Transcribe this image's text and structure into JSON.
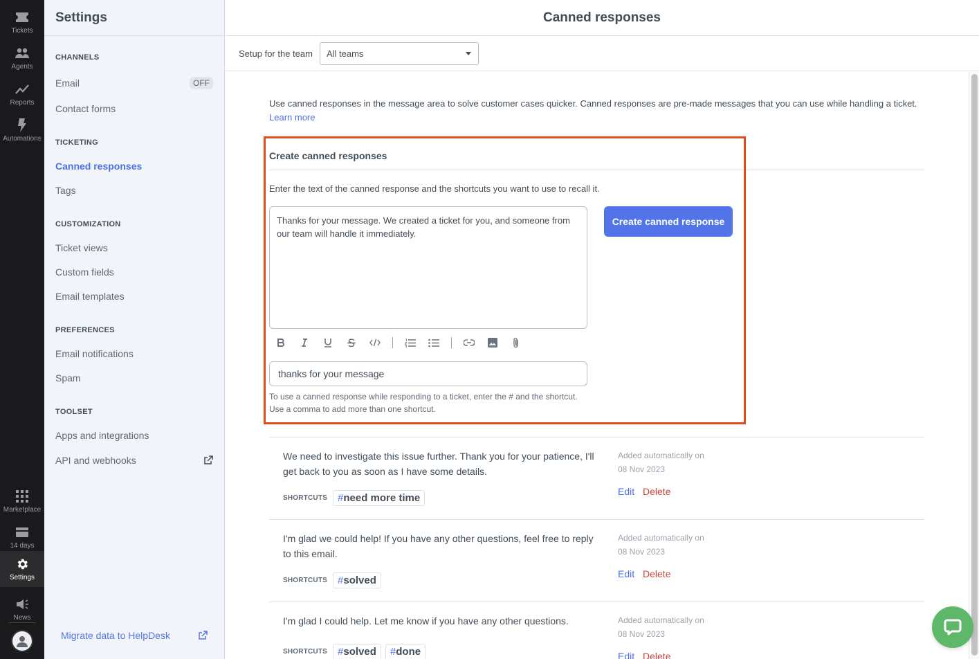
{
  "rail": {
    "items": [
      {
        "label": "Tickets",
        "icon": "ticket-icon"
      },
      {
        "label": "Agents",
        "icon": "agents-icon"
      },
      {
        "label": "Reports",
        "icon": "reports-icon"
      },
      {
        "label": "Automations",
        "icon": "lightning-icon"
      }
    ],
    "bottom": [
      {
        "label": "Marketplace",
        "icon": "grid-icon"
      },
      {
        "label": "14 days",
        "icon": "card-icon"
      },
      {
        "label": "Settings",
        "icon": "gear-icon",
        "active": true
      },
      {
        "label": "News",
        "icon": "megaphone-icon"
      }
    ]
  },
  "sidebar": {
    "title": "Settings",
    "sections": [
      {
        "title": "CHANNELS",
        "items": [
          {
            "label": "Email",
            "badge": "OFF"
          },
          {
            "label": "Contact forms"
          }
        ]
      },
      {
        "title": "TICKETING",
        "items": [
          {
            "label": "Canned responses",
            "active": true
          },
          {
            "label": "Tags"
          }
        ]
      },
      {
        "title": "CUSTOMIZATION",
        "items": [
          {
            "label": "Ticket views"
          },
          {
            "label": "Custom fields"
          },
          {
            "label": "Email templates"
          }
        ]
      },
      {
        "title": "PREFERENCES",
        "items": [
          {
            "label": "Email notifications"
          },
          {
            "label": "Spam"
          }
        ]
      },
      {
        "title": "TOOLSET",
        "items": [
          {
            "label": "Apps and integrations"
          },
          {
            "label": "API and webhooks",
            "external": true
          }
        ]
      }
    ],
    "migrate_link": "Migrate data to HelpDesk"
  },
  "header": {
    "title": "Canned responses"
  },
  "team_bar": {
    "label": "Setup for the team",
    "selected": "All teams"
  },
  "intro": {
    "text": "Use canned responses in the message area to solve customer cases quicker. Canned responses are pre-made messages that you can use while handling a ticket.",
    "learn_more": "Learn more"
  },
  "create": {
    "title": "Create canned responses",
    "description": "Enter the text of the canned response and the shortcuts you want to use to recall it.",
    "editor_value": "Thanks for your message. We created a ticket for you, and someone from our team will handle it immediately.",
    "toolbar": [
      "bold",
      "italic",
      "underline",
      "strikethrough",
      "code",
      "ordered-list",
      "bullet-list",
      "link",
      "image",
      "attachment"
    ],
    "shortcut_value": "thanks for your message",
    "shortcut_help": "To use a canned response while responding to a ticket, enter the # and the shortcut. Use a comma to add more than one shortcut.",
    "button": "Create canned response"
  },
  "responses": [
    {
      "text": "We need to investigate this issue further. Thank you for your patience, I'll get back to you as soon as I have some details.",
      "shortcuts_label": "SHORTCUTS",
      "tags": [
        "need more time"
      ],
      "meta_line1": "Added automatically on",
      "meta_line2": "08 Nov 2023",
      "edit": "Edit",
      "delete": "Delete"
    },
    {
      "text": "I'm glad we could help! If you have any other questions, feel free to reply to this email.",
      "shortcuts_label": "SHORTCUTS",
      "tags": [
        "solved"
      ],
      "meta_line1": "Added automatically on",
      "meta_line2": "08 Nov 2023",
      "edit": "Edit",
      "delete": "Delete"
    },
    {
      "text": "I'm glad I could help. Let me know if you have any other questions.",
      "shortcuts_label": "SHORTCUTS",
      "tags": [
        "solved",
        "done"
      ],
      "meta_line1": "Added automatically on",
      "meta_line2": "08 Nov 2023",
      "edit": "Edit",
      "delete": "Delete"
    }
  ],
  "tag_hash": "#",
  "colors": {
    "accent": "#5274e8",
    "highlight": "#e14a1c",
    "delete": "#c9463d",
    "chat": "#5fb86a"
  }
}
